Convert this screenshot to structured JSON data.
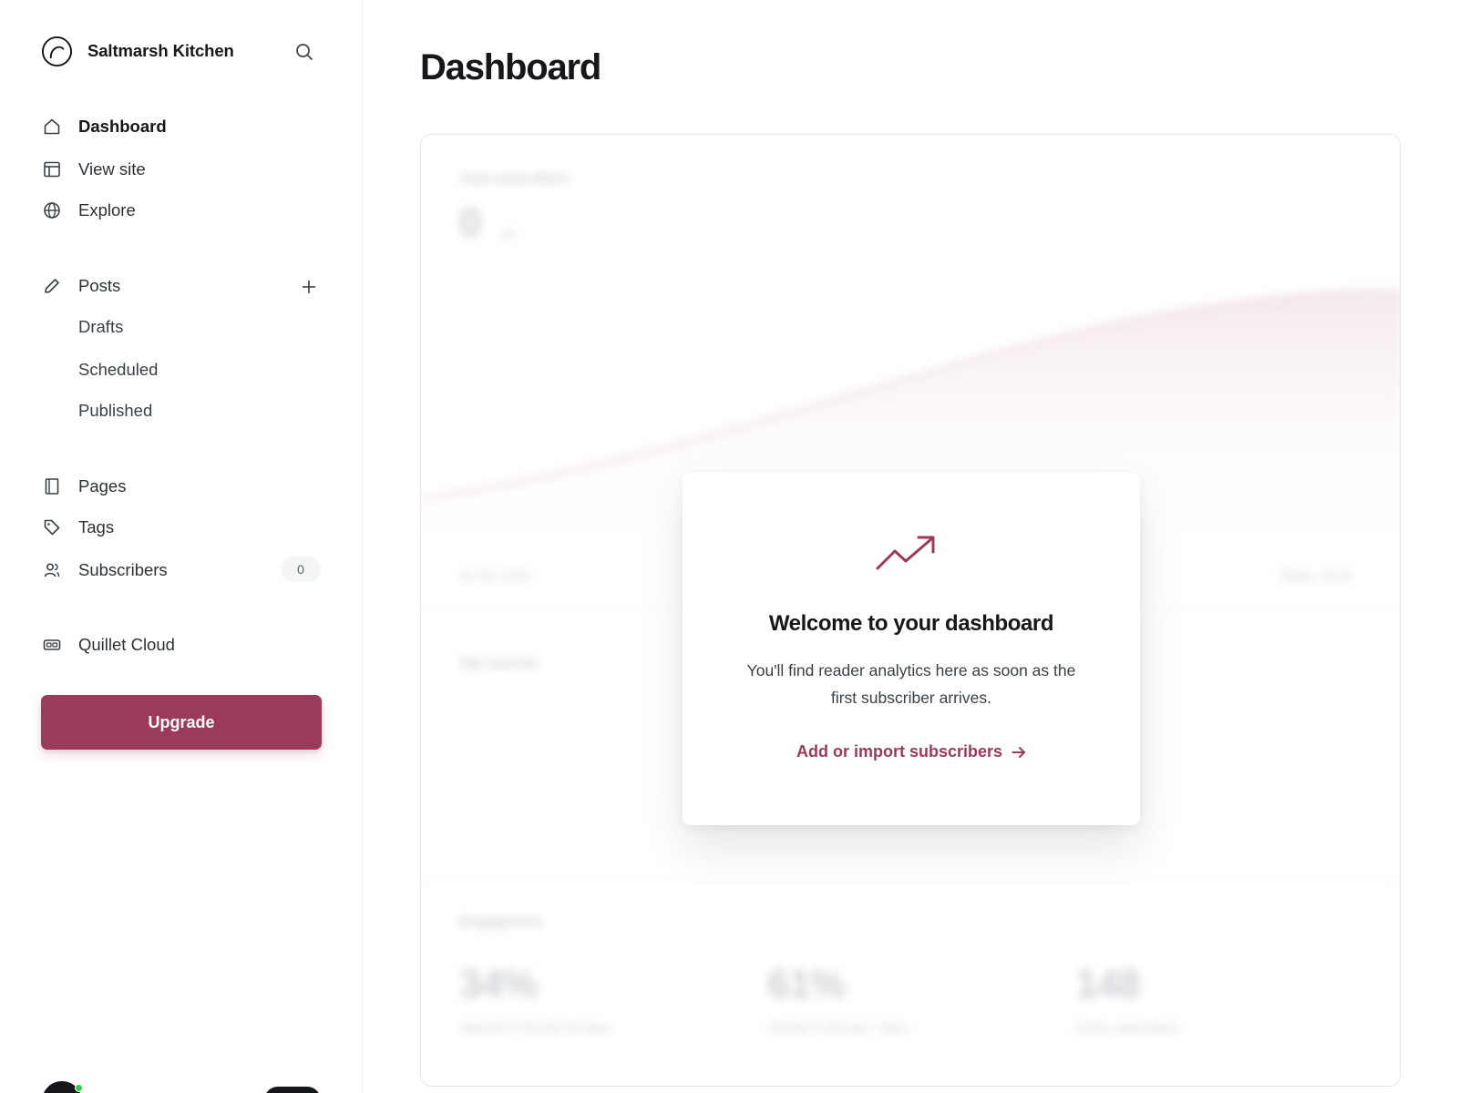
{
  "brand": {
    "name": "Saltmarsh Kitchen",
    "logo_icon": "circle-arc-logo-icon"
  },
  "sidebar": {
    "search_icon": "search-icon",
    "nav": [
      {
        "label": "Dashboard",
        "icon": "home-icon",
        "active": true
      },
      {
        "label": "View site",
        "icon": "layout-icon"
      },
      {
        "label": "Explore",
        "icon": "globe-icon"
      }
    ],
    "posts": {
      "label": "Posts",
      "icon": "pencil-icon",
      "add_icon": "plus-icon",
      "sub": [
        "Drafts",
        "Scheduled",
        "Published"
      ]
    },
    "nav2": [
      {
        "label": "Pages",
        "icon": "page-icon"
      },
      {
        "label": "Tags",
        "icon": "tag-icon"
      },
      {
        "label": "Subscribers",
        "icon": "users-icon",
        "count": "0"
      }
    ],
    "cloud": {
      "label": "Quillet Cloud",
      "icon": "cloud-box-icon"
    },
    "upgrade_label": "Upgrade"
  },
  "main": {
    "title": "Dashboard",
    "blurred": {
      "total_label": "Total subscribers",
      "total_value": "0",
      "total_unit": "all",
      "start_date": "16 Jan 2025",
      "end_date": "Today, 16:44",
      "top_sources": "Top sources",
      "engagement_label": "Engagement",
      "metrics": [
        {
          "value": "34%",
          "label": "Opened in the last 30 days"
        },
        {
          "value": "61%",
          "label": "Clicked in the last 7 days"
        },
        {
          "value": "148",
          "label": "Active subscribers"
        }
      ]
    },
    "welcome": {
      "icon": "trend-up-icon",
      "title": "Welcome to your dashboard",
      "text": "You'll find reader analytics here as soon as the first subscriber arrives.",
      "link": "Add or import subscribers",
      "link_icon": "arrow-right-icon"
    }
  },
  "colors": {
    "accent": "#9c3a5b",
    "text": "#15171a",
    "muted": "#394047",
    "border": "#e6e9eb"
  }
}
